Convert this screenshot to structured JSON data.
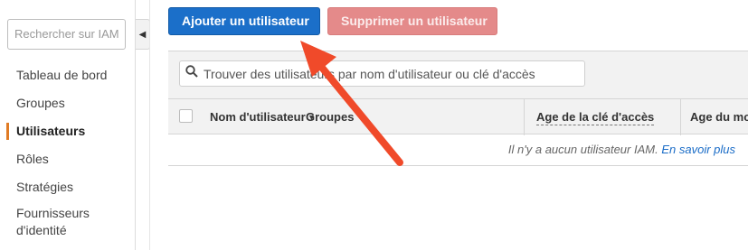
{
  "sidebar": {
    "search_placeholder": "Rechercher sur IAM",
    "items": [
      {
        "label": "Tableau de bord"
      },
      {
        "label": "Groupes"
      },
      {
        "label": "Utilisateurs"
      },
      {
        "label": "Rôles"
      },
      {
        "label": "Stratégies"
      },
      {
        "label": "Fournisseurs d'identité"
      }
    ],
    "active_index": 2
  },
  "toolbar": {
    "add_label": "Ajouter un utilisateur",
    "delete_label": "Supprimer un utilisateur"
  },
  "table": {
    "search_placeholder": "Trouver des utilisateurs par nom d'utilisateur ou clé d'accès",
    "columns": {
      "name": "Nom d'utilisateur",
      "groups": "Groupes",
      "key_age": "Age de la clé d'accès",
      "password_age": "Age du mot de passe"
    },
    "empty_message": "Il n'y a aucun utilisateur IAM.",
    "learn_more": "En savoir plus"
  },
  "colors": {
    "primary": "#1b6fc9",
    "danger": "#e48a8a",
    "active_accent": "#e07b24",
    "annotation_arrow": "#f04a2a",
    "link": "#1a6cc7"
  },
  "icons": [
    "search-icon",
    "chevron-left-icon",
    "sort-caret-icon",
    "annotation-arrow"
  ]
}
